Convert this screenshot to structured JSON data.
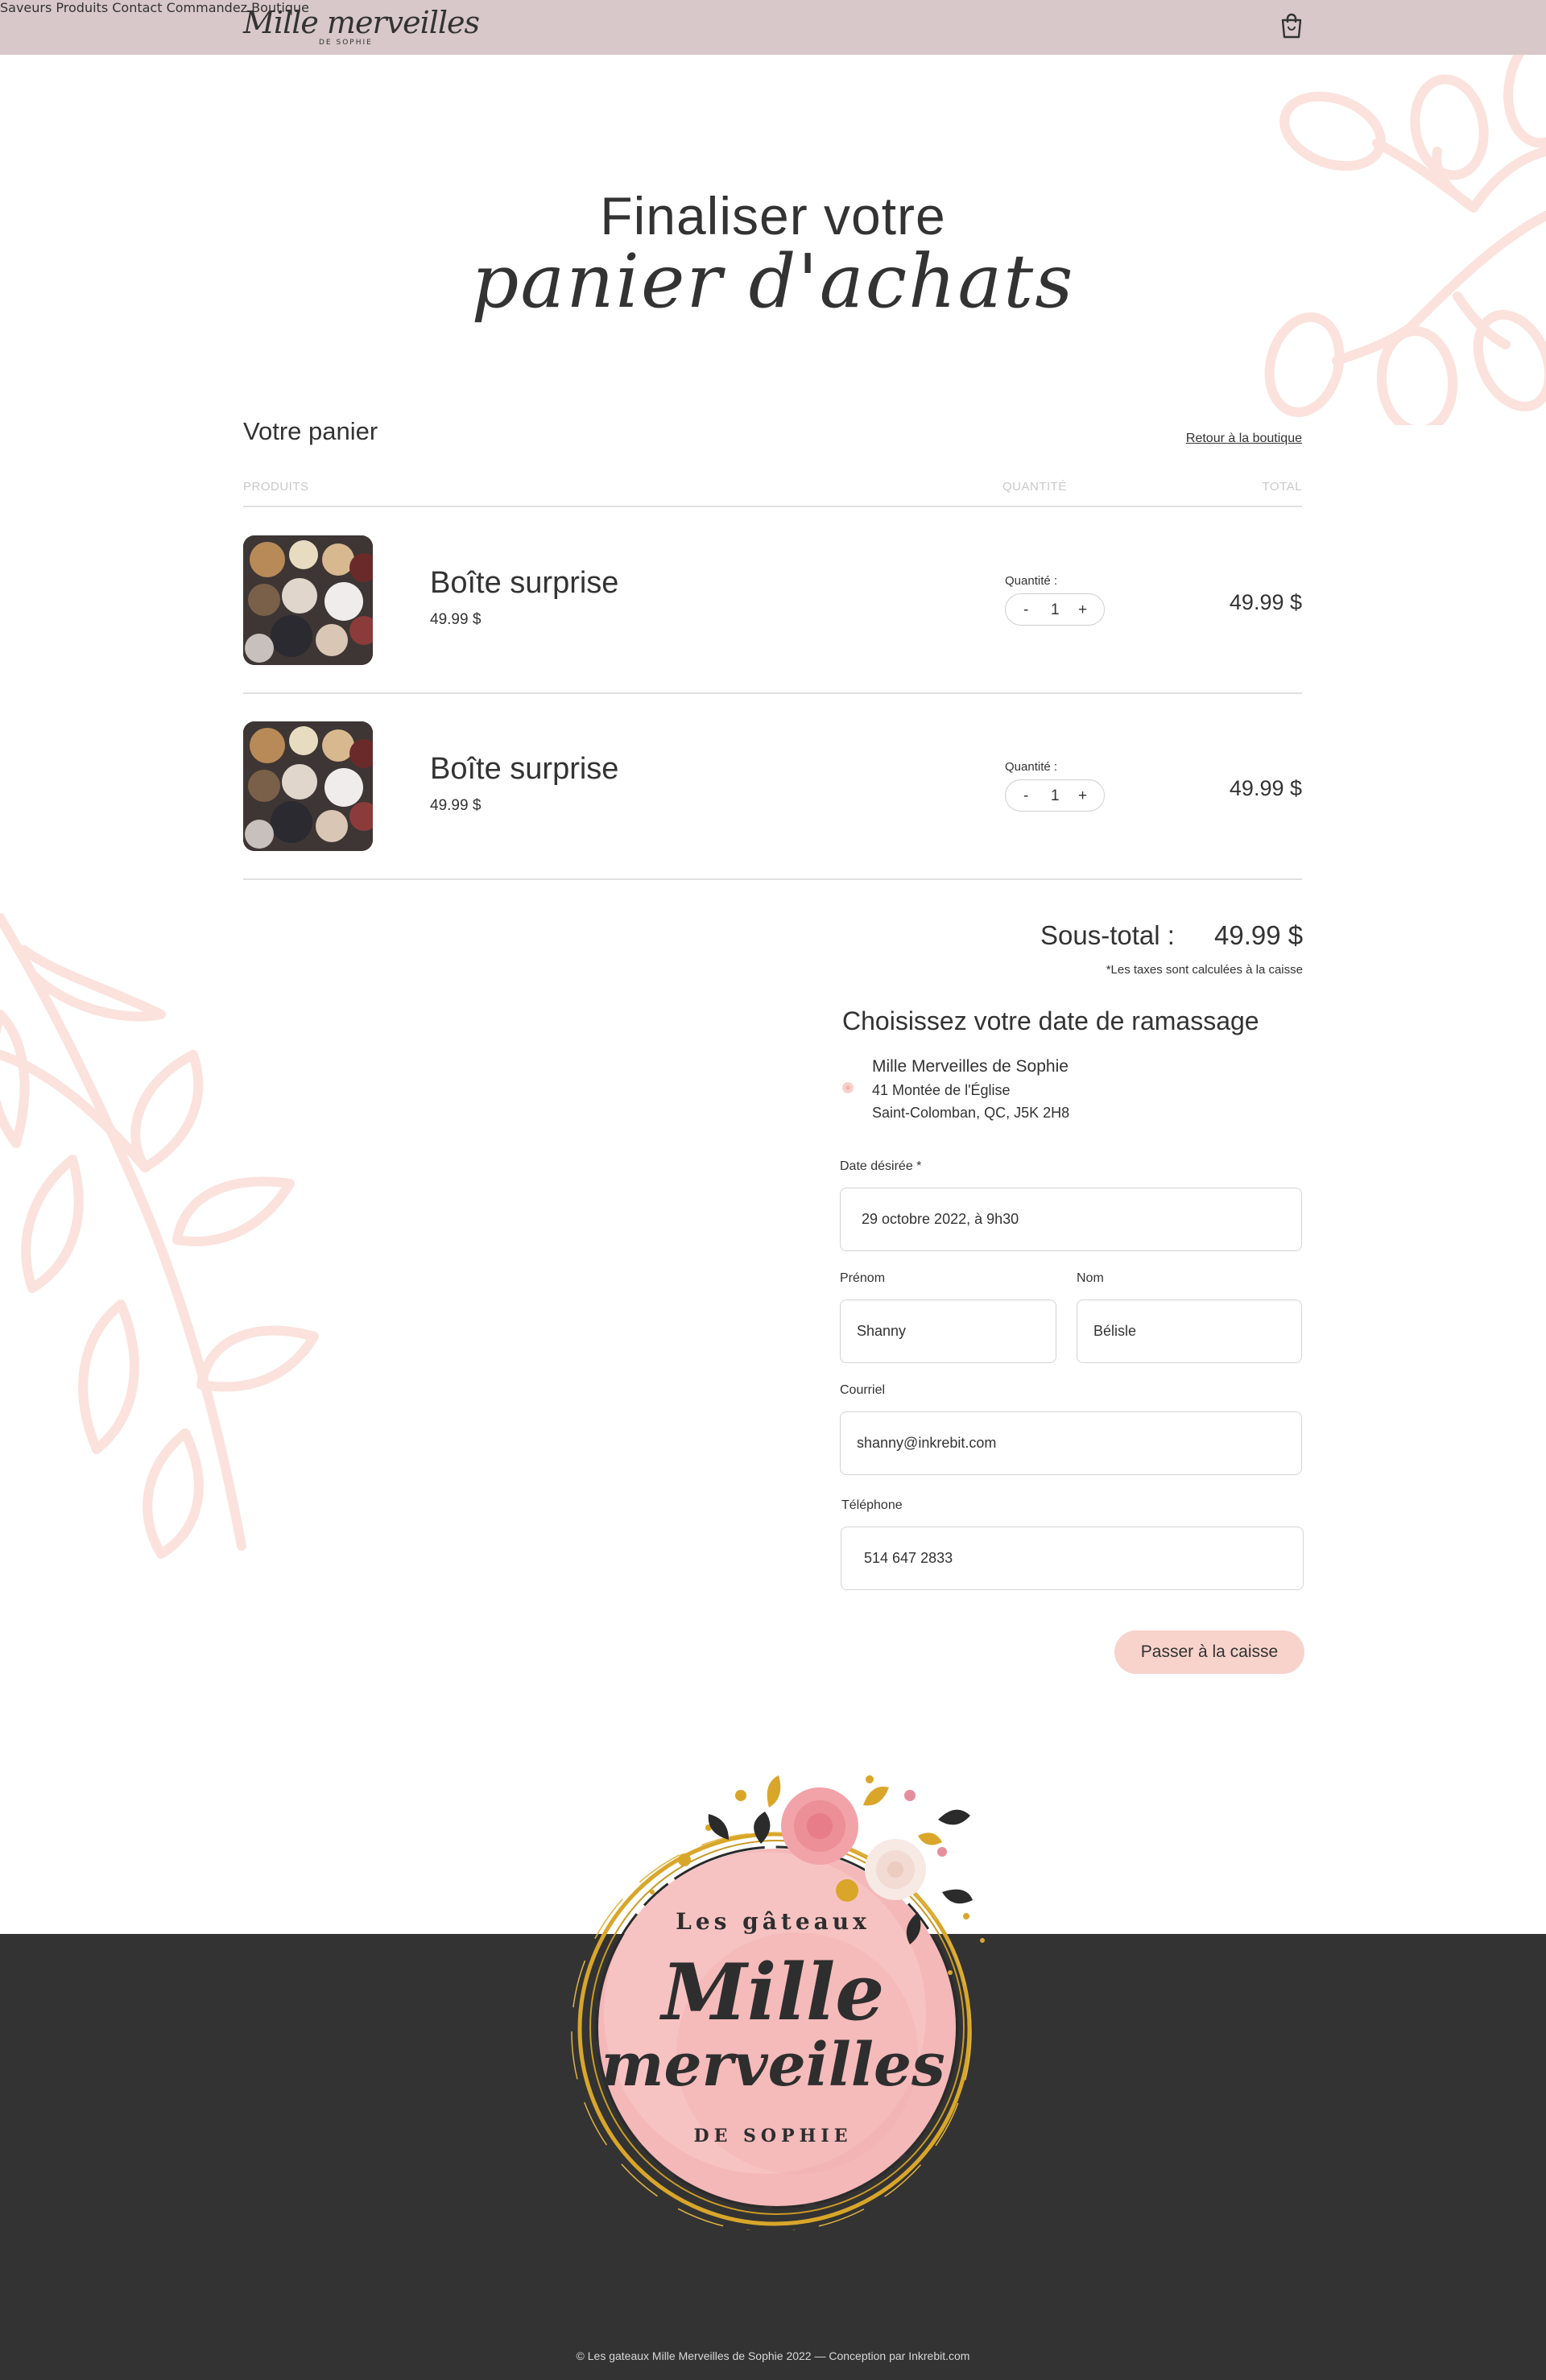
{
  "header": {
    "logo_script": "Mille merveilles",
    "logo_sub": "DE SOPHIE",
    "nav": [
      "Saveurs",
      "Produits",
      "Contact",
      "Commandez",
      "Boutique"
    ],
    "cart_icon": "shopping-bag-icon"
  },
  "title": {
    "line1": "Finaliser votre",
    "line2": "panier d'achats"
  },
  "cart": {
    "heading": "Votre panier",
    "back_link": "Retour à la boutique",
    "columns": {
      "products": "PRODUITS",
      "quantity": "QUANTITÉ",
      "total": "TOTAL"
    },
    "items": [
      {
        "name": "Boîte surprise",
        "price": "49.99 $",
        "qty_label": "Quantité :",
        "minus": "-",
        "qty": "1",
        "plus": "+",
        "total": "49.99 $"
      },
      {
        "name": "Boîte surprise",
        "price": "49.99 $",
        "qty_label": "Quantité :",
        "minus": "-",
        "qty": "1",
        "plus": "+",
        "total": "49.99 $"
      }
    ],
    "subtotal_label": "Sous-total :",
    "subtotal_value": "49.99 $",
    "tax_note": "*Les taxes sont calculées à la caisse"
  },
  "pickup": {
    "title": "Choisissez votre date de ramassage",
    "location": {
      "name": "Mille Merveilles de Sophie",
      "address1": "41 Montée de l'Église",
      "address2": "Saint-Colomban, QC, J5K 2H8"
    },
    "date_label": "Date désirée *",
    "date_value": "29 octobre 2022, à 9h30",
    "first_name_label": "Prénom",
    "first_name_value": "Shanny",
    "last_name_label": "Nom",
    "last_name_value": "Bélisle",
    "email_label": "Courriel",
    "email_value": "shanny@inkrebit.com",
    "phone_label": "Téléphone",
    "phone_value": "514 647 2833",
    "checkout_button": "Passer à la caisse"
  },
  "badge": {
    "line1": "Les gâteaux",
    "line2": "Mille",
    "line3": "merveilles",
    "line4": "DE SOPHIE"
  },
  "footer": {
    "copyright": "© Les gateaux Mille Merveilles de Sophie 2022 — Conception par Inkrebit.com"
  },
  "colors": {
    "header_bg": "#d8c8c9",
    "accent_pink": "#f7d3cb",
    "deco_pink": "#fbe5df",
    "footer_bg": "#333333"
  }
}
